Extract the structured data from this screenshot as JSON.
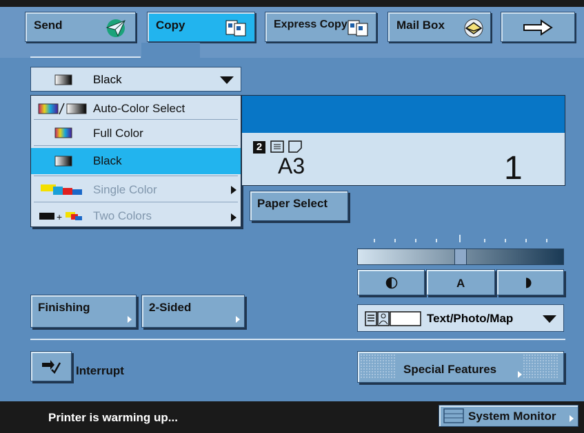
{
  "tabs": {
    "send": "Send",
    "copy": "Copy",
    "express_copy": "Express Copy",
    "mail_box": "Mail Box"
  },
  "color_dropdown": {
    "selected": "Black"
  },
  "color_menu": {
    "items": [
      {
        "label": "Auto-Color Select",
        "state": "normal"
      },
      {
        "label": "Full Color",
        "state": "normal"
      },
      {
        "label": "Black",
        "state": "selected"
      },
      {
        "label": "Single Color",
        "state": "disabled"
      },
      {
        "label": "Two Colors",
        "state": "disabled"
      }
    ]
  },
  "display": {
    "copies_badge": "2",
    "paper_size": "A3",
    "quantity": "1"
  },
  "buttons": {
    "paper_select": "Paper Select",
    "finishing": "Finishing",
    "two_sided": "2-Sided",
    "interrupt": "Interrupt",
    "special_features": "Special Features",
    "system_monitor": "System Monitor"
  },
  "density": {
    "auto_label": "A",
    "level": 0.5
  },
  "original_type": {
    "selected": "Text/Photo/Map"
  },
  "status": {
    "message": "Printer is warming up..."
  },
  "colors": {
    "background": "#5b8cbd",
    "button": "#7fa9cc",
    "active_tab": "#22b4ee",
    "selected_item": "#22b4ee",
    "display_header": "#0876c6"
  }
}
